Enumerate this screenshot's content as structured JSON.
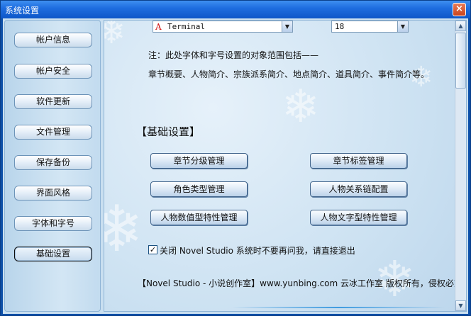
{
  "window": {
    "title": "系统设置",
    "close_glyph": "×"
  },
  "sidebar": {
    "items": [
      {
        "label": "帐户信息"
      },
      {
        "label": "帐户安全"
      },
      {
        "label": "软件更新"
      },
      {
        "label": "文件管理"
      },
      {
        "label": "保存备份"
      },
      {
        "label": "界面风格"
      },
      {
        "label": "字体和字号"
      },
      {
        "label": "基础设置"
      }
    ],
    "active_index": 7
  },
  "font_settings": {
    "font_icon": "A",
    "font_value": "Terminal",
    "size_value": "18",
    "note_line1": "注：此处字体和字号设置的对象范围包括——",
    "note_line2": "章节概要、人物简介、宗族派系简介、地点简介、道具简介、事件简介等。"
  },
  "basic": {
    "section_title": "【基础设置】",
    "buttons": [
      "章节分级管理",
      "章节标签管理",
      "角色类型管理",
      "人物关系链配置",
      "人物数值型特性管理",
      "人物文字型特性管理"
    ]
  },
  "exit_option": {
    "checked": true,
    "check_glyph": "✓",
    "label": "关闭 Novel Studio 系统时不要再问我，请直接退出"
  },
  "footer": {
    "text": "【Novel Studio - 小说创作室】www.yunbing.com 云冰工作室 版权所有，侵权必究"
  },
  "scroll": {
    "up_glyph": "▲",
    "down_glyph": "▼"
  },
  "dropdown_glyph": "▼",
  "colors": {
    "titlebar": "#1f6ee0",
    "panel": "#cde2f2",
    "accent_red": "#d01010"
  }
}
